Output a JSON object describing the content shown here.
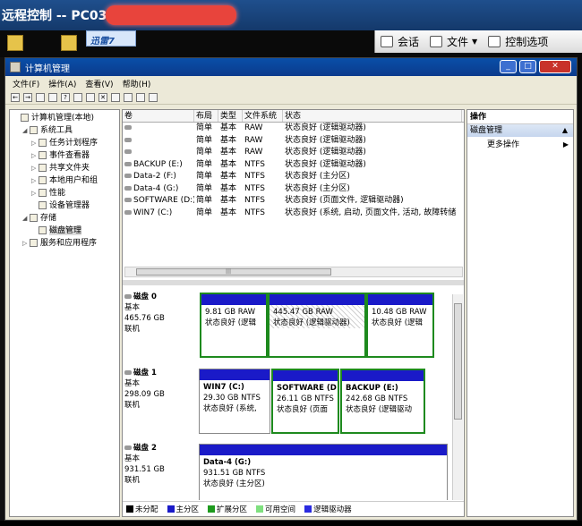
{
  "remote": {
    "title": "远程控制 -- PC03",
    "badge": "迅雷7",
    "session_btn": "会话",
    "file_btn": "文件",
    "control_btn": "控制选项"
  },
  "window": {
    "title": "计算机管理",
    "min": "_",
    "max": "□",
    "close": "✕"
  },
  "menu": [
    "文件(F)",
    "操作(A)",
    "查看(V)",
    "帮助(H)"
  ],
  "tree": [
    {
      "label": "计算机管理(本地)",
      "indent": 0,
      "exp": ""
    },
    {
      "label": "系统工具",
      "indent": 1,
      "exp": "◢"
    },
    {
      "label": "任务计划程序",
      "indent": 2,
      "exp": "▷"
    },
    {
      "label": "事件查看器",
      "indent": 2,
      "exp": "▷"
    },
    {
      "label": "共享文件夹",
      "indent": 2,
      "exp": "▷"
    },
    {
      "label": "本地用户和组",
      "indent": 2,
      "exp": "▷"
    },
    {
      "label": "性能",
      "indent": 2,
      "exp": "▷"
    },
    {
      "label": "设备管理器",
      "indent": 2,
      "exp": ""
    },
    {
      "label": "存储",
      "indent": 1,
      "exp": "◢"
    },
    {
      "label": "磁盘管理",
      "indent": 2,
      "exp": "",
      "selected": true
    },
    {
      "label": "服务和应用程序",
      "indent": 1,
      "exp": "▷"
    }
  ],
  "volumes": {
    "headers": [
      "卷",
      "布局",
      "类型",
      "文件系统",
      "状态"
    ],
    "rows": [
      [
        "",
        "简单",
        "基本",
        "RAW",
        "状态良好 (逻辑驱动器)"
      ],
      [
        "",
        "简单",
        "基本",
        "RAW",
        "状态良好 (逻辑驱动器)"
      ],
      [
        "",
        "简单",
        "基本",
        "RAW",
        "状态良好 (逻辑驱动器)"
      ],
      [
        "BACKUP (E:)",
        "简单",
        "基本",
        "NTFS",
        "状态良好 (逻辑驱动器)"
      ],
      [
        "Data-2 (F:)",
        "简单",
        "基本",
        "NTFS",
        "状态良好 (主分区)"
      ],
      [
        "Data-4 (G:)",
        "简单",
        "基本",
        "NTFS",
        "状态良好 (主分区)"
      ],
      [
        "SOFTWARE (D:)",
        "简单",
        "基本",
        "NTFS",
        "状态良好 (页面文件, 逻辑驱动器)"
      ],
      [
        "WIN7 (C:)",
        "简单",
        "基本",
        "NTFS",
        "状态良好 (系统, 启动, 页面文件, 活动, 故障转储"
      ]
    ]
  },
  "disks": [
    {
      "name": "磁盘 0",
      "type": "基本",
      "size": "465.76 GB",
      "state": "联机",
      "parts": [
        {
          "name": "",
          "size": "9.81 GB RAW",
          "status": "状态良好 (逻辑",
          "green": true,
          "hatch": false
        },
        {
          "name": "",
          "size": "445.47 GB RAW",
          "status": "状态良好 (逻辑驱动器)",
          "green": true,
          "hatch": true
        },
        {
          "name": "",
          "size": "10.48 GB RAW",
          "status": "状态良好 (逻辑",
          "green": true,
          "hatch": false
        }
      ]
    },
    {
      "name": "磁盘 1",
      "type": "基本",
      "size": "298.09 GB",
      "state": "联机",
      "parts": [
        {
          "name": "WIN7  (C:)",
          "size": "29.30 GB NTFS",
          "status": "状态良好 (系统,",
          "green": false,
          "hatch": false
        },
        {
          "name": "SOFTWARE  (D",
          "size": "26.11 GB NTFS",
          "status": "状态良好 (页面",
          "green": true,
          "hatch": false
        },
        {
          "name": "BACKUP  (E:)",
          "size": "242.68 GB NTFS",
          "status": "状态良好 (逻辑驱动",
          "green": true,
          "hatch": false
        }
      ]
    },
    {
      "name": "磁盘 2",
      "type": "基本",
      "size": "931.51 GB",
      "state": "联机",
      "parts": [
        {
          "name": "Data-4  (G:)",
          "size": "931.51 GB NTFS",
          "status": "状态良好 (主分区)",
          "green": false,
          "hatch": false
        }
      ]
    }
  ],
  "legend": [
    {
      "label": "未分配",
      "color": "#000000"
    },
    {
      "label": "主分区",
      "color": "#1a1ac8"
    },
    {
      "label": "扩展分区",
      "color": "#1e9a1e"
    },
    {
      "label": "可用空间",
      "color": "#7fe07f"
    },
    {
      "label": "逻辑驱动器",
      "color": "#2a2ae0"
    }
  ],
  "actions": {
    "header": "操作",
    "section": "磁盘管理",
    "more": "更多操作"
  }
}
